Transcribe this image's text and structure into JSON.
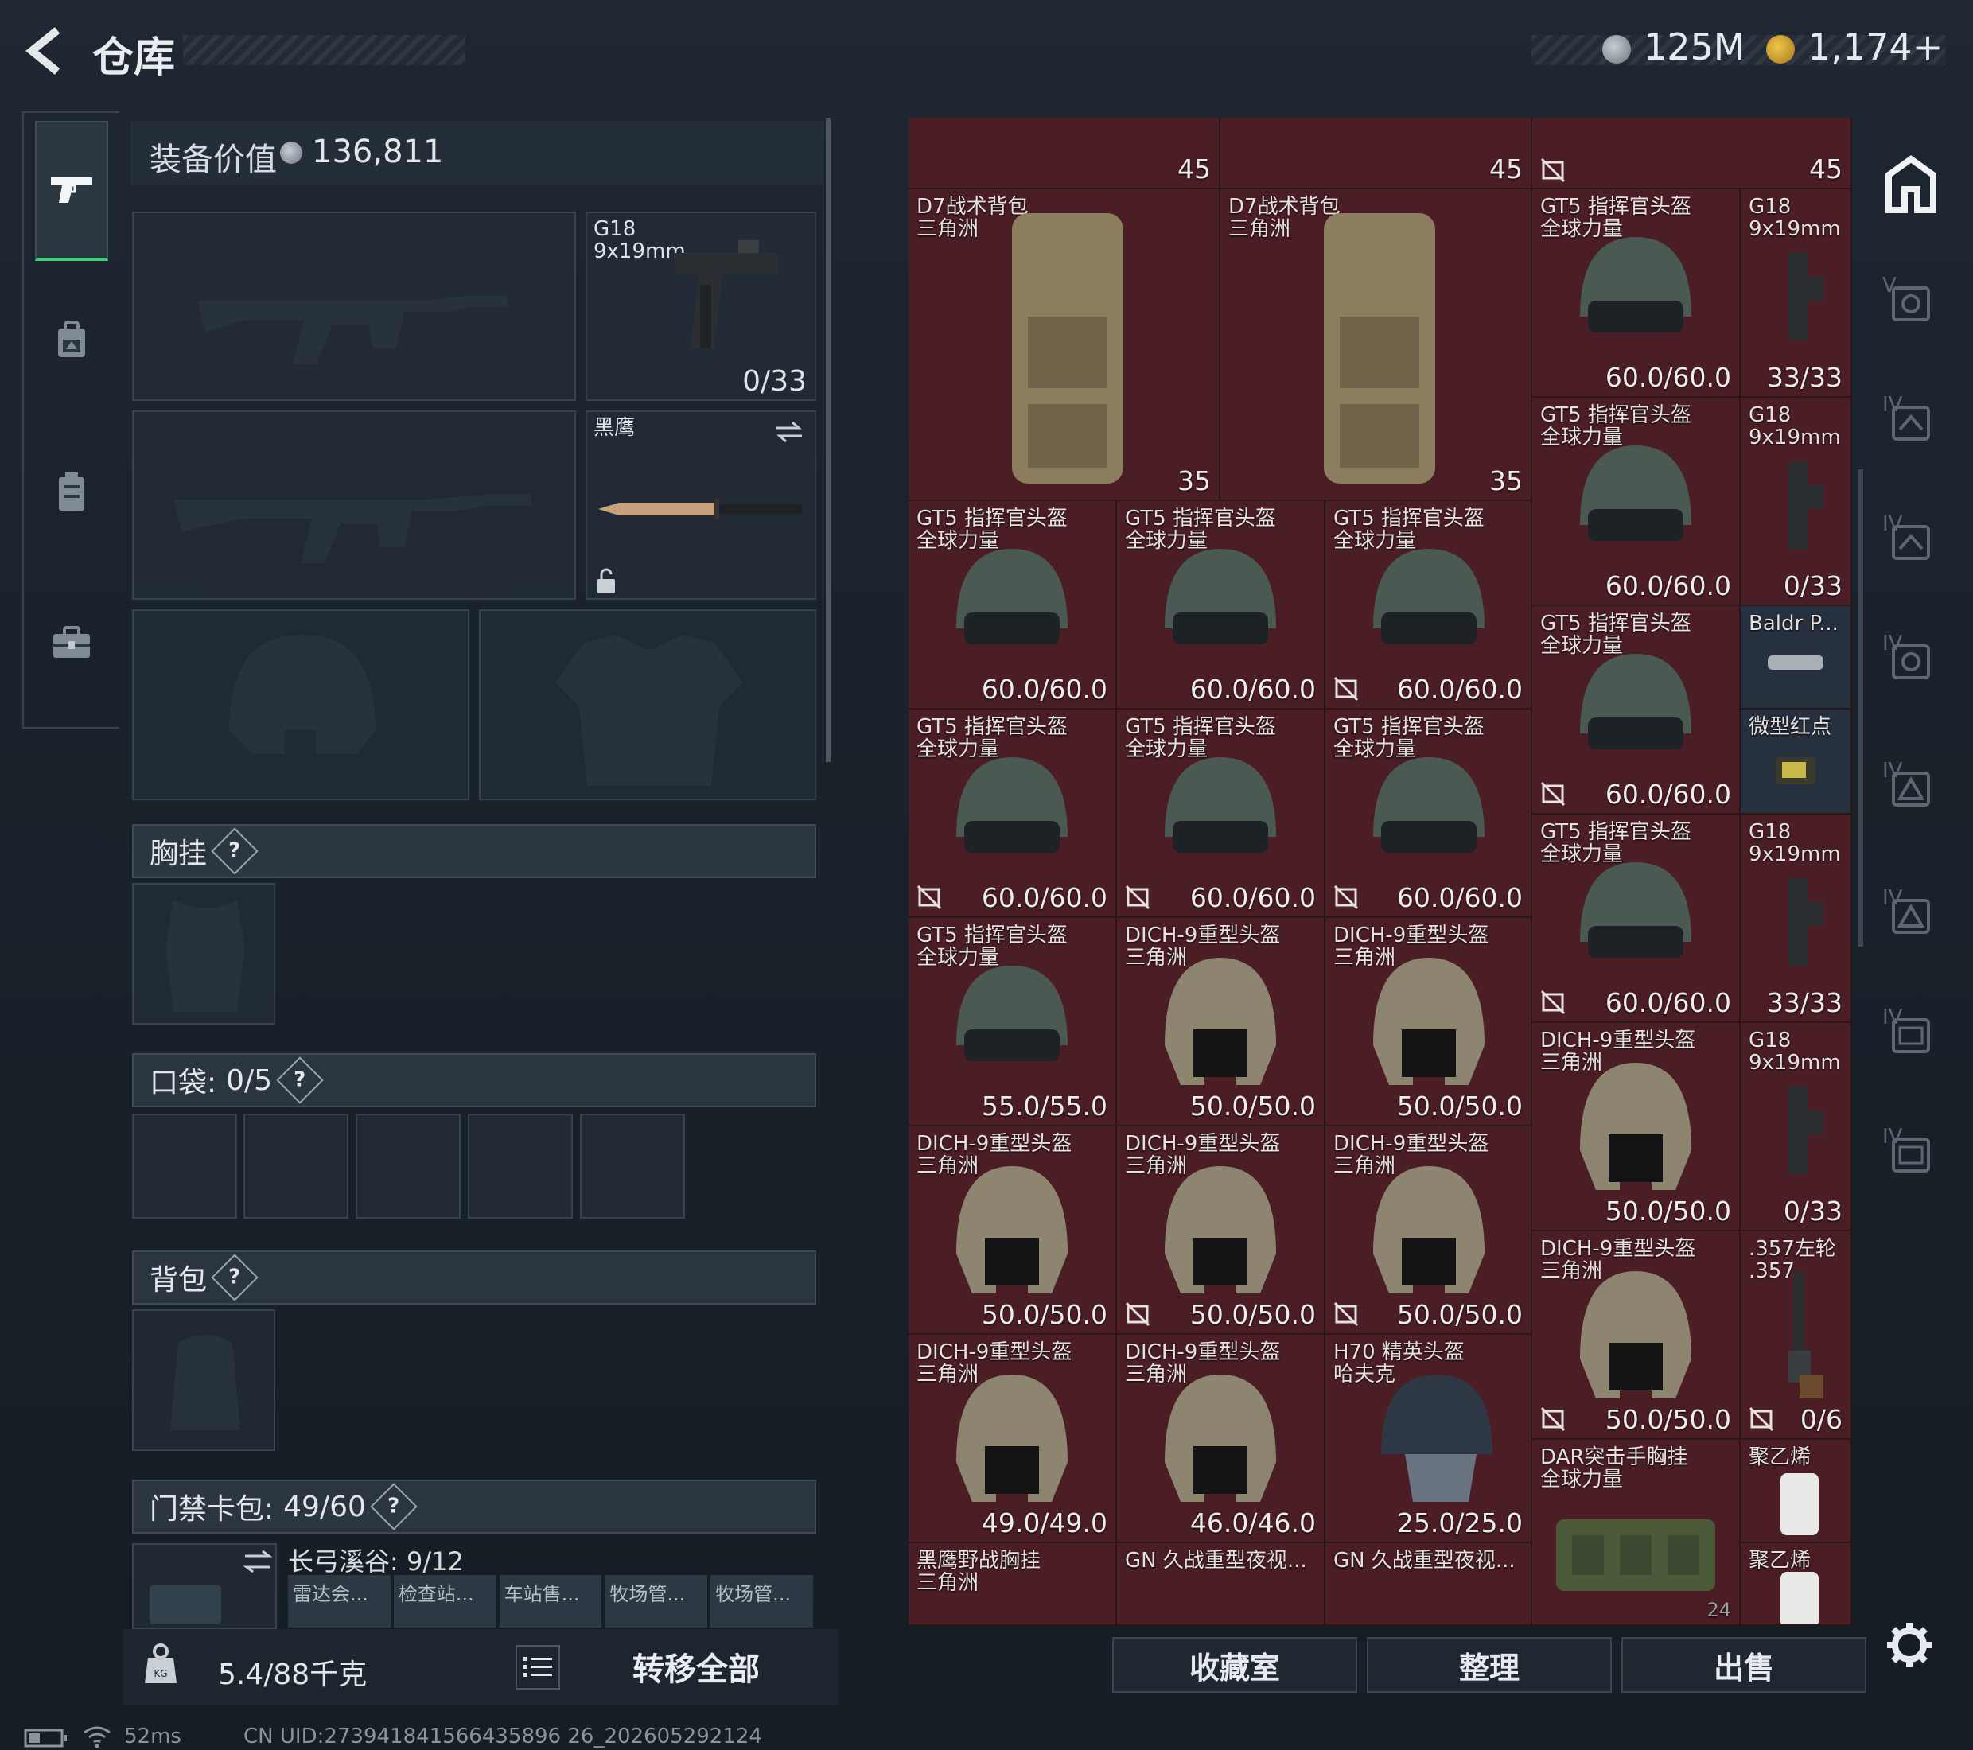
{
  "header": {
    "title": "仓库",
    "money": "125M",
    "gold": "1,174+",
    "colors": {
      "accent_green": "#3dd17c",
      "item_bg": "#4a1e24",
      "panel_bg": "#1e2732"
    }
  },
  "nav": {
    "items": [
      {
        "name": "weapons",
        "icon": "pistol-icon"
      },
      {
        "name": "backpack",
        "icon": "backpack-icon"
      },
      {
        "name": "container",
        "icon": "case-icon"
      },
      {
        "name": "toolbox",
        "icon": "briefcase-icon"
      }
    ]
  },
  "equipment": {
    "value_label": "装备价值",
    "value": "136,811",
    "sidearm": {
      "name": "G18",
      "caliber": "9x19mm",
      "ammo": "0/33"
    },
    "melee": {
      "name": "黑鹰"
    },
    "chest_rig": {
      "label": "胸挂"
    },
    "pockets": {
      "label": "口袋:",
      "count": "0/5"
    },
    "backpack": {
      "label": "背包"
    },
    "keycard": {
      "label": "门禁卡包:",
      "count": "49/60"
    },
    "map_name": "长弓溪谷: 9/12",
    "keys": [
      "雷达会...",
      "检查站...",
      "车站售...",
      "牧场管...",
      "牧场管..."
    ],
    "help": "?"
  },
  "footer_left": {
    "weight": "5.4/88千克",
    "transfer_all": "转移全部"
  },
  "stash": {
    "items": [
      {
        "id": "top1",
        "value": "45"
      },
      {
        "id": "top2",
        "value": "45"
      },
      {
        "id": "top3",
        "value": "45"
      },
      {
        "id": "bp1",
        "name": "D7战术背包",
        "sub": "三角洲",
        "value": "35"
      },
      {
        "id": "bp2",
        "name": "D7战术背包",
        "sub": "三角洲",
        "value": "35"
      },
      {
        "id": "gt1",
        "name": "GT5 指挥官头盔",
        "sub": "全球力量",
        "value": "60.0/60.0"
      },
      {
        "id": "g18a",
        "name": "G18",
        "sub": "9x19mm",
        "value": "33/33"
      },
      {
        "id": "gt2",
        "name": "GT5 指挥官头盔",
        "sub": "全球力量",
        "value": "60.0/60.0"
      },
      {
        "id": "g18b",
        "name": "G18",
        "sub": "9x19mm",
        "value": "0/33"
      },
      {
        "id": "gt3",
        "name": "GT5 指挥官头盔",
        "sub": "全球力量",
        "value": "60.0/60.0"
      },
      {
        "id": "gt4",
        "name": "GT5 指挥官头盔",
        "sub": "全球力量",
        "value": "60.0/60.0"
      },
      {
        "id": "gt5",
        "name": "GT5 指挥官头盔",
        "sub": "全球力量",
        "value": "60.0/60.0"
      },
      {
        "id": "gt6",
        "name": "GT5 指挥官头盔",
        "sub": "全球力量",
        "value": "60.0/60.0"
      },
      {
        "id": "baldr",
        "name": "Baldr P..."
      },
      {
        "id": "reddot",
        "name": "微型红点"
      },
      {
        "id": "gt7",
        "name": "GT5 指挥官头盔",
        "sub": "全球力量",
        "value": "60.0/60.0"
      },
      {
        "id": "gt8",
        "name": "GT5 指挥官头盔",
        "sub": "全球力量",
        "value": "60.0/60.0"
      },
      {
        "id": "gt9",
        "name": "GT5 指挥官头盔",
        "sub": "全球力量",
        "value": "60.0/60.0"
      },
      {
        "id": "gt10",
        "name": "GT5 指挥官头盔",
        "sub": "全球力量",
        "value": "60.0/60.0"
      },
      {
        "id": "g18c",
        "name": "G18",
        "sub": "9x19mm",
        "value": "33/33"
      },
      {
        "id": "gt11",
        "name": "GT5 指挥官头盔",
        "sub": "全球力量",
        "value": "55.0/55.0"
      },
      {
        "id": "di1",
        "name": "DICH-9重型头盔",
        "sub": "三角洲",
        "value": "50.0/50.0"
      },
      {
        "id": "di2",
        "name": "DICH-9重型头盔",
        "sub": "三角洲",
        "value": "50.0/50.0"
      },
      {
        "id": "di3",
        "name": "DICH-9重型头盔",
        "sub": "三角洲",
        "value": "50.0/50.0"
      },
      {
        "id": "g18d",
        "name": "G18",
        "sub": "9x19mm",
        "value": "0/33"
      },
      {
        "id": "di4",
        "name": "DICH-9重型头盔",
        "sub": "三角洲",
        "value": "50.0/50.0"
      },
      {
        "id": "di5",
        "name": "DICH-9重型头盔",
        "sub": "三角洲",
        "value": "50.0/50.0"
      },
      {
        "id": "di6",
        "name": "DICH-9重型头盔",
        "sub": "三角洲",
        "value": "50.0/50.0"
      },
      {
        "id": "di7",
        "name": "DICH-9重型头盔",
        "sub": "三角洲",
        "value": "50.0/50.0"
      },
      {
        "id": "rev",
        "name": ".357左轮",
        "sub": ".357",
        "value": "0/6"
      },
      {
        "id": "di8",
        "name": "DICH-9重型头盔",
        "sub": "三角洲",
        "value": "49.0/49.0"
      },
      {
        "id": "di9",
        "name": "DICH-9重型头盔",
        "sub": "三角洲",
        "value": "46.0/46.0"
      },
      {
        "id": "h70",
        "name": "H70 精英头盔",
        "sub": "哈夫克",
        "value": "25.0/25.0"
      },
      {
        "id": "dar",
        "name": "DAR突击手胸挂",
        "sub": "全球力量",
        "value": "24"
      },
      {
        "id": "pe1",
        "name": "聚乙烯"
      },
      {
        "id": "bh",
        "name": "黑鹰野战胸挂",
        "sub": "三角洲"
      },
      {
        "id": "gn1",
        "name": "GN 久战重型夜视..."
      },
      {
        "id": "gn2",
        "name": "GN 久战重型夜视..."
      },
      {
        "id": "pe2",
        "name": "聚乙烯"
      }
    ]
  },
  "footer_right": {
    "collection": "收藏室",
    "sort": "整理",
    "sell": "出售"
  },
  "status": {
    "ping": "52ms",
    "uid": "CN UID:273941841566435896 26_202605292124"
  },
  "side_tiers": [
    "V",
    "IV",
    "IV",
    "IV",
    "IV",
    "IV",
    "IV",
    "IV"
  ]
}
